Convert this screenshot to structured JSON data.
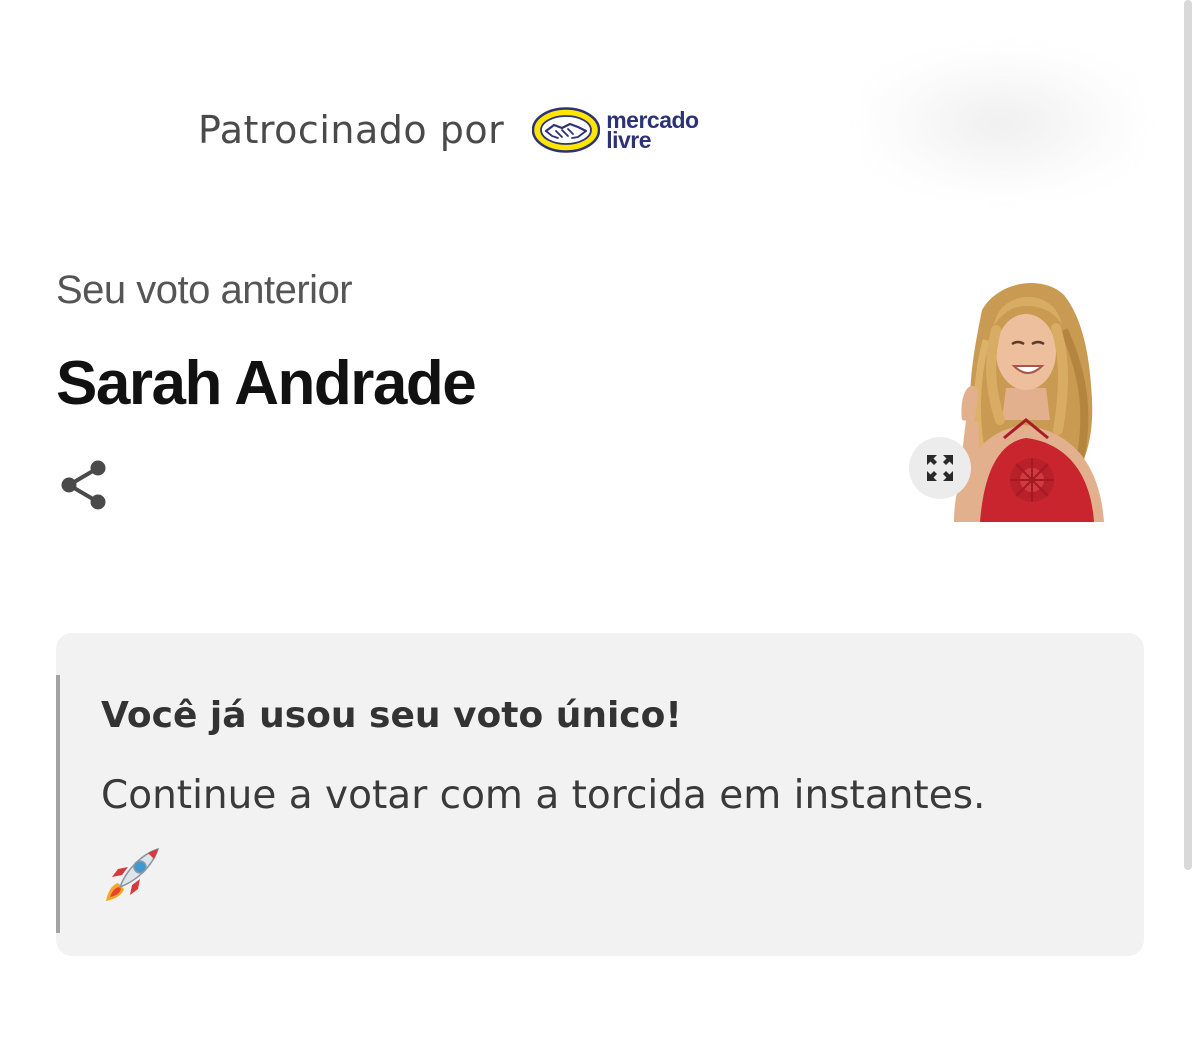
{
  "sponsor": {
    "label": "Patrocinado por",
    "logo_line1": "mercado",
    "logo_line2": "livre",
    "logo_name": "mercado-livre-logo",
    "colors": {
      "badge": "#FFE600",
      "text": "#2D3277"
    }
  },
  "vote": {
    "previous_label": "Seu voto anterior",
    "candidate_name": "Sarah Andrade"
  },
  "notice": {
    "title": "Você já usou seu voto único!",
    "text": "Continue a votar com a torcida em instantes.",
    "emoji_icon": "rocket-icon"
  },
  "icons": {
    "share": "share-icon",
    "expand": "expand-icon"
  },
  "colors": {
    "notice_bg": "#F2F2F2",
    "notice_bar": "#A3A3A3",
    "dress": "#C8252F"
  }
}
